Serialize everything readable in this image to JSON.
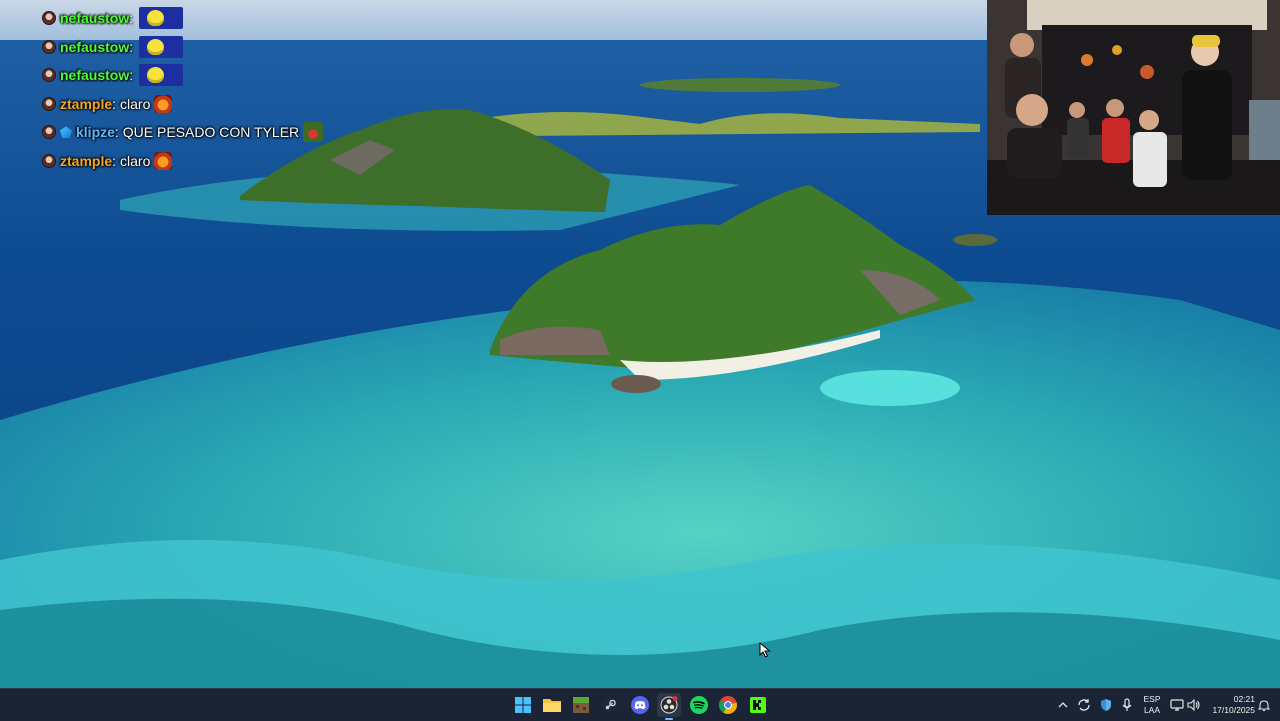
{
  "chat": {
    "messages": [
      {
        "user": "nefaustow",
        "text": "",
        "user_color": "#4cff33",
        "emote": "emote-yellow"
      },
      {
        "user": "nefaustow",
        "text": "",
        "user_color": "#4cff33",
        "emote": "emote-yellow"
      },
      {
        "user": "nefaustow",
        "text": "",
        "user_color": "#4cff33",
        "emote": "emote-yellow"
      },
      {
        "user": "ztample",
        "text": "claro",
        "user_color": "#f5a623",
        "emote": "emote-fire"
      },
      {
        "user": "klipze",
        "text": "QUE PESADO CON TYLER",
        "user_color": "#5cb8ff",
        "emote": "emote-face"
      },
      {
        "user": "ztample",
        "text": "claro",
        "user_color": "#f5a623",
        "emote": "emote-fire"
      }
    ]
  },
  "taskbar": {
    "apps": [
      {
        "name": "windows-start-icon"
      },
      {
        "name": "file-explorer-icon"
      },
      {
        "name": "minecraft-icon"
      },
      {
        "name": "steam-icon"
      },
      {
        "name": "discord-icon"
      },
      {
        "name": "obs-icon"
      },
      {
        "name": "spotify-icon"
      },
      {
        "name": "chrome-icon"
      },
      {
        "name": "kick-icon"
      }
    ],
    "tray": {
      "language_line1": "ESP",
      "language_line2": "LAA",
      "time": "02:21",
      "date": "17/10/2025"
    }
  },
  "colors": {
    "taskbar_bg": "#1b2434",
    "ocean_deep": "#0a3d7a",
    "lagoon": "#27c2c6",
    "island_green": "#3f7a2a"
  }
}
